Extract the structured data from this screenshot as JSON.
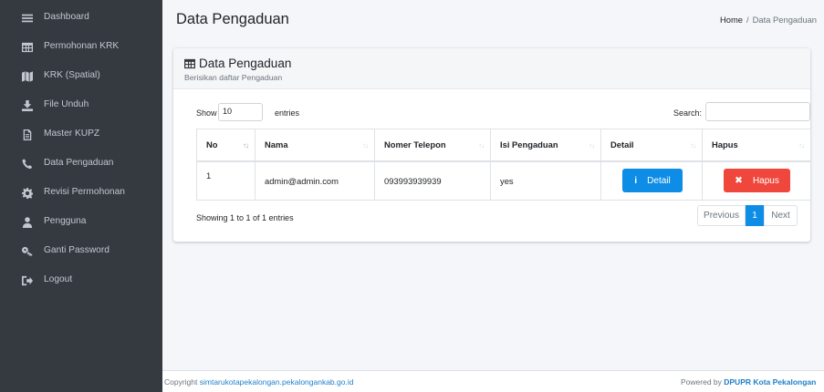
{
  "sidebar": {
    "items": [
      {
        "label": "Dashboard",
        "icon": "menu-icon"
      },
      {
        "label": "Permohonan KRK",
        "icon": "table-icon"
      },
      {
        "label": "KRK (Spatial)",
        "icon": "map-icon"
      },
      {
        "label": "File Unduh",
        "icon": "download-icon"
      },
      {
        "label": "Master KUPZ",
        "icon": "file-icon"
      },
      {
        "label": "Data Pengaduan",
        "icon": "phone-icon"
      },
      {
        "label": "Revisi Permohonan",
        "icon": "gear-icon"
      },
      {
        "label": "Pengguna",
        "icon": "user-icon"
      },
      {
        "label": "Ganti Password",
        "icon": "key-icon"
      },
      {
        "label": "Logout",
        "icon": "sign-out-icon"
      }
    ]
  },
  "header": {
    "title": "Data Pengaduan",
    "breadcrumb": {
      "home": "Home",
      "separator": "/",
      "current": "Data Pengaduan"
    }
  },
  "card": {
    "title": "Data Pengaduan",
    "title_icon": "table-icon",
    "subtitle": "Berisikan daftar Pengaduan",
    "length": {
      "show_label": "Show",
      "value": "10",
      "entries_label": "entries"
    },
    "search": {
      "label": "Search:",
      "value": ""
    },
    "table": {
      "columns": [
        "No",
        "Nama",
        "Nomer Telepon",
        "Isi Pengaduan",
        "Detail",
        "Hapus"
      ],
      "sort_glyph": "↑↓",
      "rows": [
        {
          "no": "1",
          "nama": "admin@admin.com",
          "telepon": "093993939939",
          "isi": "yes",
          "detail_icon": "i",
          "detail_label": "Detail",
          "hapus_icon": "✖",
          "hapus_label": "Hapus"
        }
      ]
    },
    "info": "Showing 1 to 1 of 1 entries",
    "pagination": {
      "previous": "Previous",
      "current": "1",
      "next": "Next"
    }
  },
  "footer": {
    "copyright_prefix": "Copyright ",
    "copyright_link": "simtarukotapekalongan.pekalongankab.go.id",
    "powered_prefix": "Powered by ",
    "powered_brand": "DPUPR Kota Pekalongan"
  },
  "colors": {
    "sidebar_bg": "#343a40",
    "page_bg": "#f4f6f9",
    "primary": "#0d8de6",
    "danger": "#f0473c",
    "link": "#1f7fc9"
  }
}
